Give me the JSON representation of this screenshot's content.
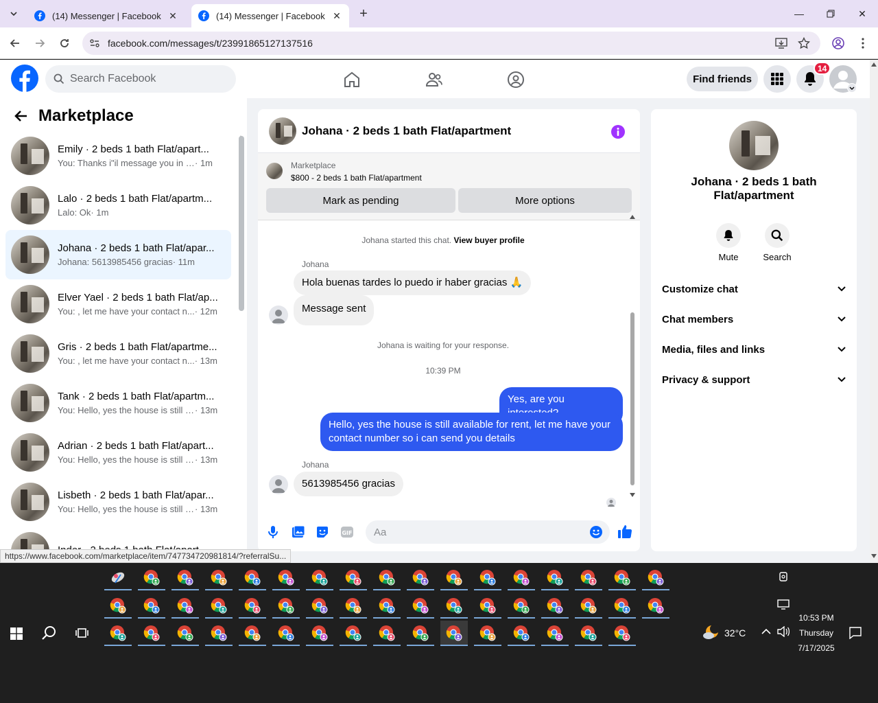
{
  "browser": {
    "tabs": [
      {
        "title": "(14) Messenger | Facebook",
        "active": false
      },
      {
        "title": "(14) Messenger | Facebook",
        "active": true
      }
    ],
    "url": "facebook.com/messages/t/23991865127137516",
    "status_url": "https://www.facebook.com/marketplace/item/747734720981814/?referralSu..."
  },
  "header": {
    "search_placeholder": "Search Facebook",
    "find_friends": "Find friends",
    "notif_count": "14"
  },
  "left": {
    "title": "Marketplace",
    "conversations": [
      {
        "name": "Emily · 2 beds 1 bath Flat/apart...",
        "preview": "You: Thanks i\"il message you in a ...",
        "time": "· 1m",
        "selected": false
      },
      {
        "name": "Lalo · 2 beds 1 bath Flat/apartm...",
        "preview": "Lalo: Ok",
        "time": "· 1m",
        "selected": false
      },
      {
        "name": "Johana · 2 beds 1 bath Flat/apar...",
        "preview": "Johana: 5613985456 gracias",
        "time": "· 11m",
        "selected": true
      },
      {
        "name": "Elver Yael · 2 beds 1 bath Flat/ap...",
        "preview": "You: , let me have your contact n...",
        "time": "· 12m",
        "selected": false
      },
      {
        "name": "Gris · 2 beds 1 bath Flat/apartme...",
        "preview": "You: , let me have your contact n...",
        "time": "· 13m",
        "selected": false
      },
      {
        "name": "Tank · 2 beds 1 bath Flat/apartm...",
        "preview": "You: Hello, yes the house is still a...",
        "time": "· 13m",
        "selected": false
      },
      {
        "name": "Adrian · 2 beds 1 bath Flat/apart...",
        "preview": "You: Hello, yes the house is still a...",
        "time": "· 13m",
        "selected": false
      },
      {
        "name": "Lisbeth · 2 beds 1 bath Flat/apar...",
        "preview": "You: Hello, yes the house is still a...",
        "time": "· 13m",
        "selected": false
      },
      {
        "name": "Inder · 2 beds 1 bath Flat/apart...",
        "preview": "",
        "time": "",
        "selected": false
      }
    ]
  },
  "chat": {
    "title": "Johana · 2 beds 1 bath Flat/apartment",
    "marketplace_label": "Marketplace",
    "listing": "$800 - 2 beds 1 bath Flat/apartment",
    "mark_pending": "Mark as pending",
    "more_options": "More options",
    "started_text": "Johana started this chat.",
    "view_profile": "View buyer profile",
    "sender1": "Johana",
    "msg1": "Hola buenas tardes lo puedo ir haber gracias 🙏",
    "msg2": "Message sent",
    "waiting": "Johana is waiting for your response.",
    "time": "10:39 PM",
    "out1": "Yes, are you interested?",
    "out2": "Hello, yes the house is still available for rent, let me have your contact number so i can send you details",
    "sender2": "Johana",
    "msg3": "5613985456 gracias",
    "input_placeholder": "Aa"
  },
  "right": {
    "name": "Johana · 2 beds 1 bath Flat/apartment",
    "mute": "Mute",
    "search": "Search",
    "sections": [
      "Customize chat",
      "Chat members",
      "Media, files and links",
      "Privacy & support"
    ]
  },
  "taskbar": {
    "temp": "32°C",
    "time": "10:53 PM",
    "day": "Thursday",
    "date": "7/17/2025"
  },
  "colors": {
    "fb_blue": "#0866ff",
    "outgoing_bubble": "#2e59f0",
    "notif_red": "#e41e3f",
    "info_purple": "#a033ff"
  }
}
